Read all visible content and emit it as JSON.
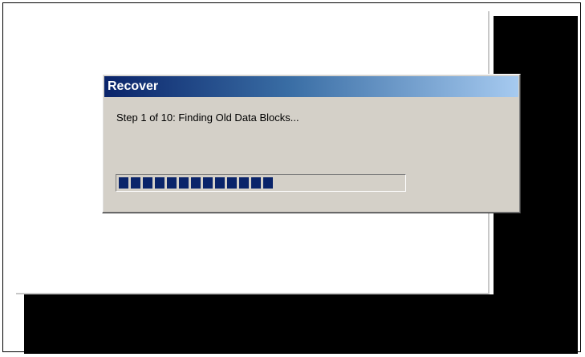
{
  "dialog": {
    "title": "Recover",
    "message": "Step 1 of 10: Finding Old Data Blocks...",
    "progress": {
      "fraction": 0.53,
      "block_count": 13
    }
  },
  "colors": {
    "titlebar_start": "#0a246a",
    "titlebar_end": "#a6caf0",
    "progress_fill": "#0a246a",
    "dialog_bg": "#d4d0c8"
  }
}
